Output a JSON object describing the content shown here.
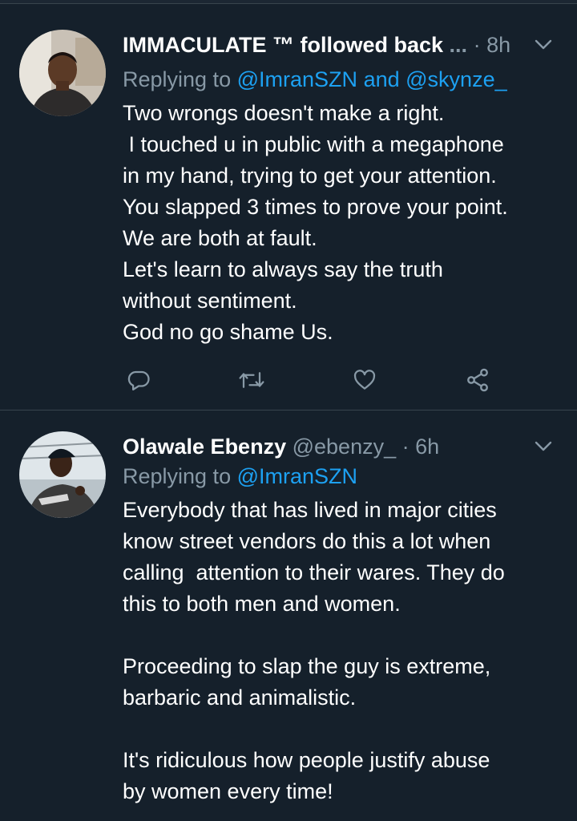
{
  "tweets": [
    {
      "author_name": "IMMACULATE ™ followed back",
      "truncation": "...",
      "separator": "·",
      "time": "8h",
      "replying_prefix": "Replying to",
      "mentions": [
        "@ImranSZN",
        "@skynze_"
      ],
      "mention_joiner": "and",
      "body_lines": [
        "Two wrongs doesn't make a right.",
        " I touched u in public with a megaphone",
        "in my hand, trying to get your attention.",
        "You slapped 3 times to prove your point.",
        "We are both at fault.",
        "Let's learn to always say the truth",
        "without sentiment.",
        "God no go shame Us."
      ],
      "actions": [
        "reply-icon",
        "retweet-icon",
        "like-icon",
        "share-icon"
      ]
    },
    {
      "author_name": "Olawale Ebenzy",
      "handle": "@ebenzy_",
      "separator": "·",
      "time": "6h",
      "replying_prefix": "Replying to",
      "mentions": [
        "@ImranSZN"
      ],
      "body_lines": [
        "Everybody that has lived in major cities",
        "know street vendors do this a lot when",
        "calling  attention to their wares. They do",
        "this to both men and women.",
        "",
        "Proceeding to slap the guy is extreme,",
        "barbaric and animalistic.",
        "",
        "It's ridiculous how people justify abuse",
        "by women every time!"
      ]
    }
  ],
  "colors": {
    "background": "#15202b",
    "secondary_text": "#8899a6",
    "link": "#1da1f2",
    "divider": "#38444d"
  }
}
